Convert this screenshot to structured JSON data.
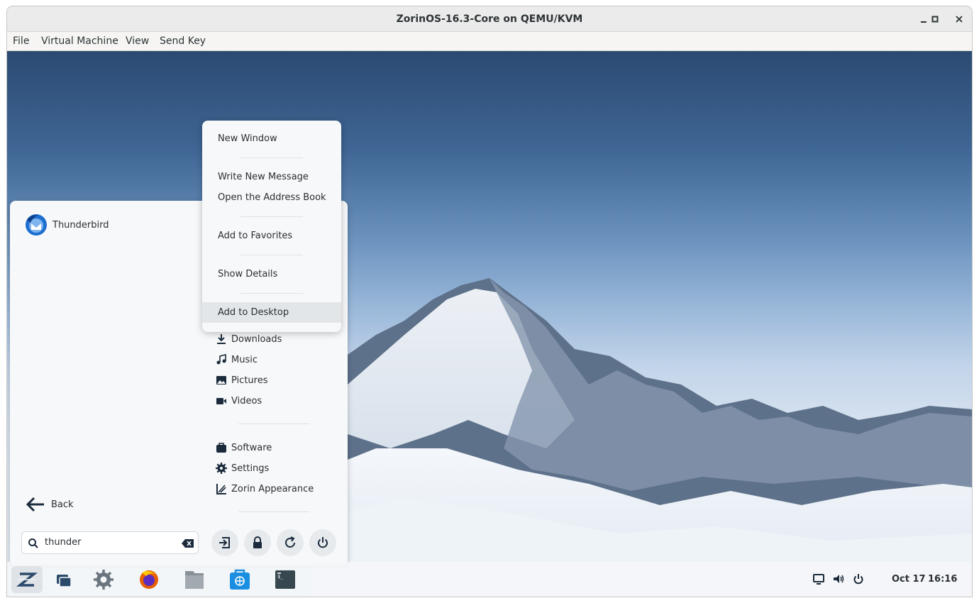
{
  "window": {
    "title": "ZorinOS-16.3-Core on QEMU/KVM",
    "minimize": "▁",
    "maximize": "□",
    "close": "✕"
  },
  "menubar": [
    "File",
    "Virtual Machine",
    "View",
    "Send Key"
  ],
  "start_menu": {
    "result_app": "Thunderbird",
    "places": [
      "Downloads",
      "Music",
      "Pictures",
      "Videos"
    ],
    "system": [
      "Software",
      "Settings",
      "Zorin Appearance"
    ],
    "back_label": "Back",
    "search_value": "thunder",
    "power_buttons": [
      "log-out-icon",
      "lock-icon",
      "restart-icon",
      "power-icon"
    ]
  },
  "context_menu": {
    "items": [
      "New Window",
      "Write New Message",
      "Open the Address Book",
      "Add to Favorites",
      "Show Details",
      "Add to Desktop"
    ],
    "highlighted": "Add to Desktop"
  },
  "taskbar": {
    "apps": [
      "zorin-menu-icon",
      "windows-overview-icon",
      "settings-gear-icon",
      "firefox-icon",
      "files-icon",
      "software-store-icon",
      "terminal-icon"
    ],
    "date": "Oct 17",
    "time": "16:16"
  },
  "colors": {
    "accent": "#1e4f8a",
    "menu_bg": "#f7f8f9",
    "highlight": "#e3e6e9"
  }
}
